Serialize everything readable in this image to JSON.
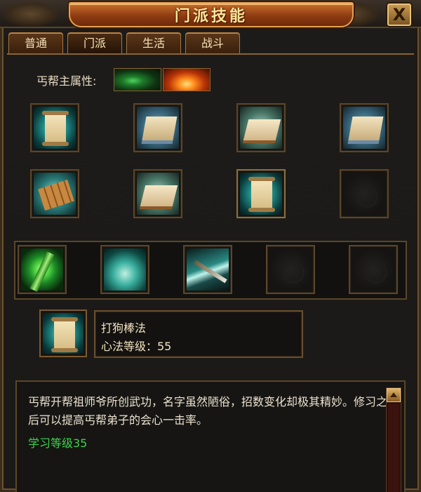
{
  "window": {
    "title": "门派技能",
    "close_label": "X"
  },
  "tabs": [
    {
      "label": "普通",
      "active": false
    },
    {
      "label": "门派",
      "active": true
    },
    {
      "label": "生活",
      "active": false
    },
    {
      "label": "战斗",
      "active": false
    }
  ],
  "attributes": {
    "label": "丐帮主属性:",
    "icons": [
      "poison-attribute-icon",
      "fire-attribute-icon"
    ]
  },
  "skill_grid": [
    [
      "scroll-icon",
      "book-icon",
      "open-book-icon",
      "books-icon"
    ],
    [
      "bamboo-bundle-icon",
      "open-book-icon",
      "scroll-icon",
      "empty-slot"
    ]
  ],
  "active_skills": [
    "green-bamboo-staff-icon",
    "wolf-icon",
    "spear-icon",
    "empty-slot",
    "empty-slot"
  ],
  "selected_skill": {
    "icon": "scroll-icon",
    "name": "打狗棒法",
    "level_text": "心法等级：55"
  },
  "description": {
    "text": "丐帮开帮祖师爷所创武功，名字虽然陋俗，招数变化却极其精妙。修习之后可以提高丐帮弟子的会心一击率。",
    "requirement": "学习等级35"
  },
  "colors": {
    "title_text": "#ffe79a",
    "requirement_text": "#3ed44a",
    "frame_border": "#8a6432"
  }
}
